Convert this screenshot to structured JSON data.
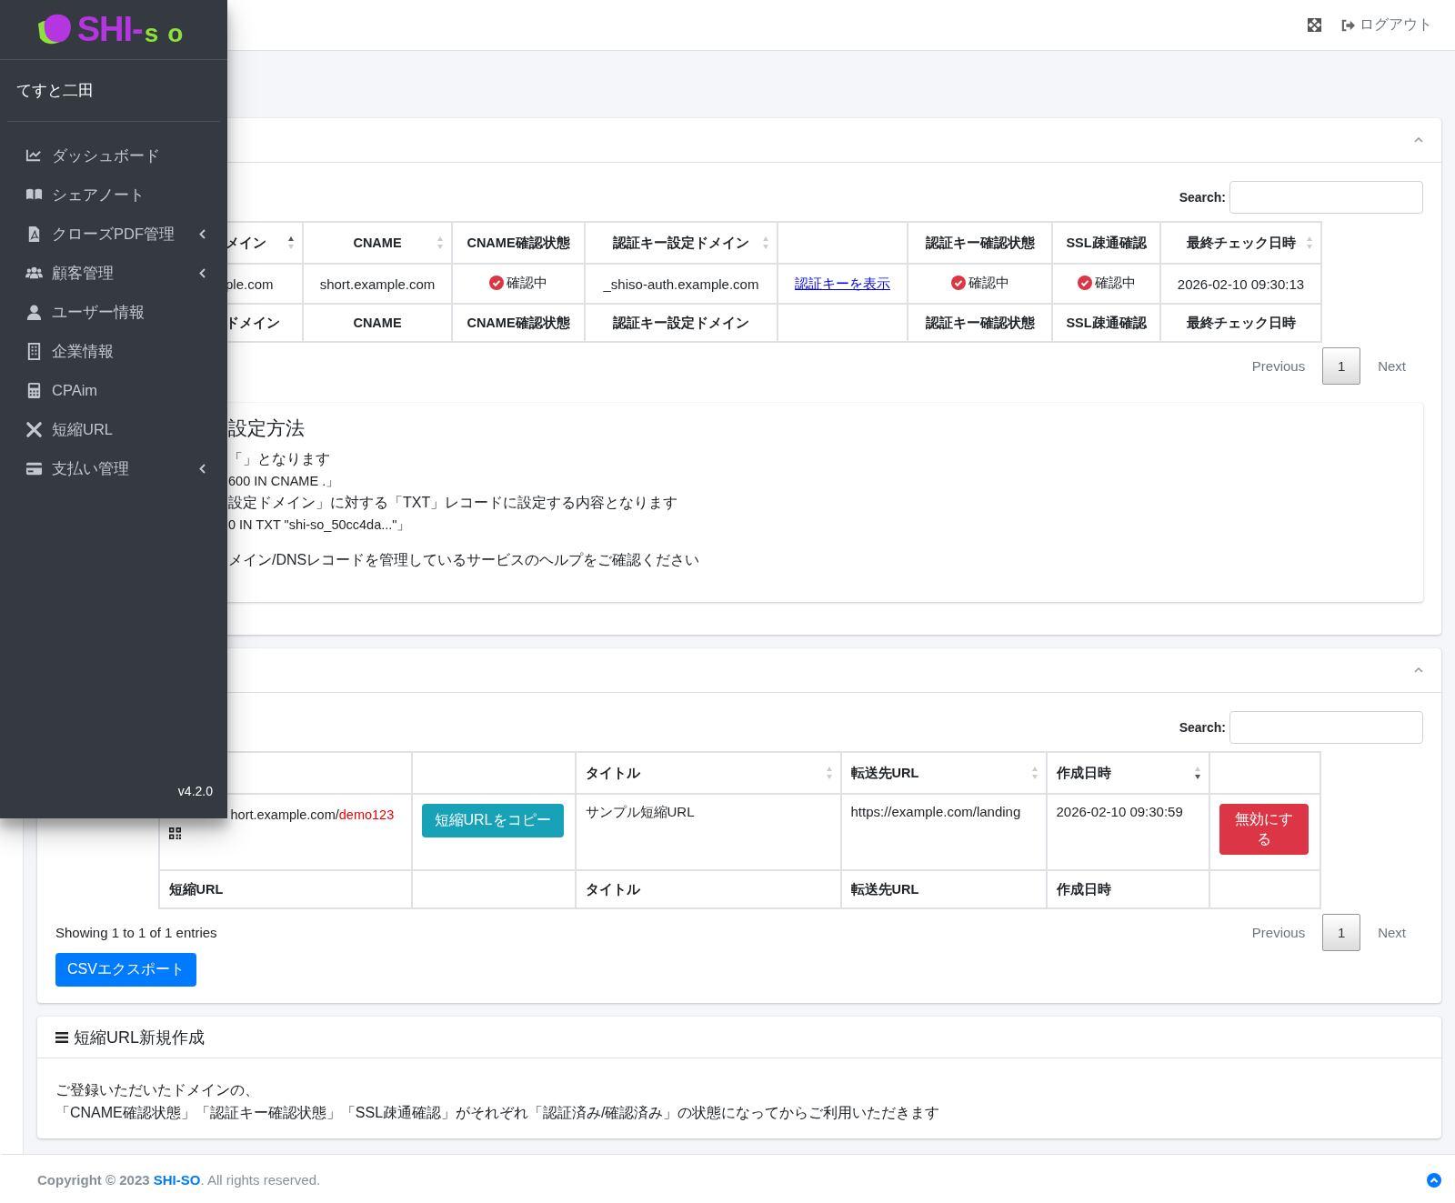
{
  "sidebar": {
    "logo": {
      "main": "SHI-",
      "accent": "so"
    },
    "user": "てすと二田",
    "items": [
      {
        "label": "ダッシュボード",
        "has_submenu": false
      },
      {
        "label": "シェアノート",
        "has_submenu": false
      },
      {
        "label": "クローズPDF管理",
        "has_submenu": true
      },
      {
        "label": "顧客管理",
        "has_submenu": true
      },
      {
        "label": "ユーザー情報",
        "has_submenu": false
      },
      {
        "label": "企業情報",
        "has_submenu": false
      },
      {
        "label": "CPAim",
        "has_submenu": false
      },
      {
        "label": "短縮URL",
        "has_submenu": false
      },
      {
        "label": "支払い管理",
        "has_submenu": true
      }
    ],
    "version": "v4.2.0"
  },
  "topbar": {
    "logout": "ログアウト"
  },
  "domain_card": {
    "search_label": "Search:",
    "columns": [
      {
        "label": "メイン",
        "sortable": true,
        "sorted": true,
        "descending": false
      },
      {
        "label": "CNAME",
        "sortable": true,
        "sorted": false
      },
      {
        "label": "CNAME確認状態",
        "sortable": false
      },
      {
        "label": "認証キー設定ドメイン",
        "sortable": true,
        "sorted": false
      },
      {
        "sortable": false
      },
      {
        "label": "認証キー確認状態",
        "sortable": false
      },
      {
        "label": "SSL疎通確認",
        "sortable": false
      },
      {
        "label": "最終チェック日時",
        "sortable": true,
        "sorted": false
      }
    ],
    "rows": [
      {
        "cells": [
          {
            "kind": "text",
            "text": "ple.com"
          },
          {
            "kind": "text",
            "text": "short.example.com"
          },
          {
            "kind": "status",
            "text": "確認中"
          },
          {
            "kind": "text",
            "text": "_shiso-auth.example.com"
          },
          {
            "kind": "link",
            "text": "認証キーを表示"
          },
          {
            "kind": "status",
            "text": "確認中"
          },
          {
            "kind": "status",
            "text": "確認中"
          },
          {
            "kind": "text",
            "text": "2026-02-10 09:30:13"
          }
        ]
      }
    ],
    "footer_row": [
      {
        "kind": "text",
        "text": "ドメイン"
      },
      {
        "kind": "text",
        "text": "CNAME"
      },
      {
        "kind": "text",
        "text": "CNAME確認状態"
      },
      {
        "kind": "text",
        "text": "認証キー設定ドメイン"
      },
      {
        "kind": "blank"
      },
      {
        "kind": "text",
        "text": "認証キー確認状態"
      },
      {
        "kind": "text",
        "text": "SSL疎通確認"
      },
      {
        "kind": "text",
        "text": "最終チェック日時"
      }
    ],
    "pagination": {
      "previous": {
        "label": "Previous",
        "disabled": true
      },
      "pages": [
        {
          "label": "1",
          "selected": true
        }
      ],
      "next": {
        "label": "Next",
        "disabled": true
      }
    },
    "instructions": {
      "heading": "設定方法",
      "lines": [
        {
          "kind": "text",
          "text": "「」となります"
        },
        {
          "kind": "record",
          "text": "600 IN CNAME .」"
        },
        {
          "kind": "text",
          "text": "設定ドメイン」に対する「TXT」レコードに設定する内容となります"
        },
        {
          "kind": "record",
          "text": "0 IN TXT \"shi-so_50cc4da...\"」"
        },
        {
          "kind": "note",
          "text": "メイン/DNSレコードを管理しているサービスのヘルプをご確認ください"
        }
      ]
    }
  },
  "url_card": {
    "search_label": "Search:",
    "columns": [
      {
        "sortable": false
      },
      {
        "sortable": false
      },
      {
        "label": "タイトル",
        "sortable": true,
        "sorted": false
      },
      {
        "label": "転送先URL",
        "sortable": true,
        "sorted": false
      },
      {
        "label": "作成日時",
        "sortable": true,
        "sorted": true,
        "descending": true
      },
      {
        "sortable": false
      }
    ],
    "rows": [
      {
        "cells": [
          {
            "kind": "short_url",
            "text": "hort.example.com/",
            "code": "demo123"
          },
          {
            "kind": "copy_button",
            "text": "短縮URLをコピー"
          },
          {
            "kind": "text",
            "text": "サンプル短縮URL"
          },
          {
            "kind": "text",
            "text": "https://example.com/landing"
          },
          {
            "kind": "text",
            "text": "2026-02-10 09:30:59"
          },
          {
            "kind": "danger_button",
            "text": "無効にする"
          }
        ]
      }
    ],
    "footer_row": [
      {
        "kind": "text",
        "text": "短縮URL"
      },
      {
        "kind": "blank"
      },
      {
        "kind": "text",
        "text": "タイトル"
      },
      {
        "kind": "text",
        "text": "転送先URL"
      },
      {
        "kind": "text",
        "text": "作成日時"
      },
      {
        "kind": "blank"
      }
    ],
    "info": "Showing 1 to 1 of 1 entries",
    "pagination": {
      "previous": {
        "label": "Previous",
        "disabled": true
      },
      "pages": [
        {
          "label": "1",
          "selected": true
        }
      ],
      "next": {
        "label": "Next",
        "disabled": true
      }
    },
    "export_button": "CSVエクスポート"
  },
  "create_card": {
    "title": "短縮URL新規作成",
    "lines": [
      "ご登録いただいたドメインの、",
      "「CNAME確認状態」「認証キー確認状態」「SSL疎通確認」がそれぞれ「認証済み/確認済み」の状態になってからご利用いただきます"
    ]
  },
  "footer": {
    "prefix": "Copyright © 2023",
    "link": "SHI-SO",
    "suffix": ". All rights reserved."
  }
}
